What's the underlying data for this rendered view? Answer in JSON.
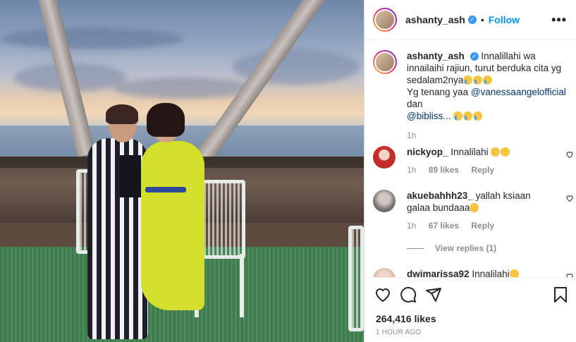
{
  "post": {
    "username": "ashanty_ash",
    "follow_label": "Follow",
    "separator": "•",
    "more_label": "•••",
    "caption": {
      "text_1": "Innalillahi wa innailaihi rajiun, turut berduka cita yg sedalam2nya",
      "text_2": "Yg tenang yaa ",
      "mention_1": "@vanessaangelofficial",
      "text_3": " dan ",
      "mention_2": "@bibliss",
      "text_4": "...",
      "time": "1h"
    },
    "comments": [
      {
        "username": "nickyop_",
        "text": "Innalilahi",
        "time": "1h",
        "likes": "89 likes",
        "reply_label": "Reply"
      },
      {
        "username": "akuebahhh23_",
        "text": "yallah ksiaan galaa bundaaa",
        "time": "1h",
        "likes": "67 likes",
        "reply_label": "Reply"
      },
      {
        "username": "dwimarissa92",
        "text": "Innalilahi"
      }
    ],
    "view_replies_label": "View replies (1)",
    "likes_count": "264,416 likes",
    "time_ago": "1 HOUR AGO"
  },
  "icons": {
    "verified": "verified-badge-icon",
    "like": "heart-icon",
    "comment": "comment-icon",
    "share": "paper-plane-icon",
    "save": "bookmark-icon"
  },
  "colors": {
    "follow": "#0095f6",
    "verified": "#3897f0",
    "muted": "#8e8e8e"
  }
}
